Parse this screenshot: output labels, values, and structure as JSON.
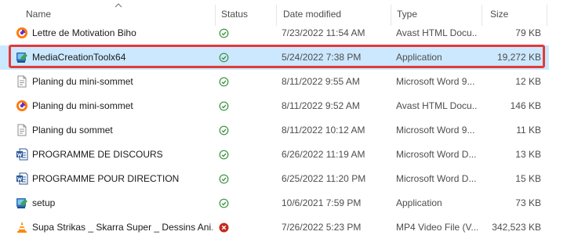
{
  "columns": {
    "name": "Name",
    "status": "Status",
    "date": "Date modified",
    "type": "Type",
    "size": "Size"
  },
  "files": [
    {
      "name": "Lettre de Motivation Biho",
      "status": "synced",
      "date": "7/23/2022 11:54 AM",
      "type": "Avast HTML Docu...",
      "size": "79 KB",
      "icon": "avast-icon"
    },
    {
      "name": "MediaCreationToolx64",
      "status": "synced",
      "date": "5/24/2022 7:38 PM",
      "type": "Application",
      "size": "19,272 KB",
      "icon": "installer-icon",
      "selected": true
    },
    {
      "name": "Planing du mini-sommet",
      "status": "synced",
      "date": "8/11/2022 9:55 AM",
      "type": "Microsoft Word 9...",
      "size": "12 KB",
      "icon": "document-icon"
    },
    {
      "name": "Planing du mini-sommet",
      "status": "synced",
      "date": "8/11/2022 9:52 AM",
      "type": "Avast HTML Docu...",
      "size": "146 KB",
      "icon": "avast-icon"
    },
    {
      "name": "Planing du sommet",
      "status": "synced",
      "date": "8/11/2022 10:12 AM",
      "type": "Microsoft Word 9...",
      "size": "11 KB",
      "icon": "document-icon"
    },
    {
      "name": "PROGRAMME DE DISCOURS",
      "status": "synced",
      "date": "6/26/2022 11:19 AM",
      "type": "Microsoft Word D...",
      "size": "13 KB",
      "icon": "word-icon"
    },
    {
      "name": "PROGRAMME POUR DIRECTION",
      "status": "synced",
      "date": "6/25/2022 11:20 PM",
      "type": "Microsoft Word D...",
      "size": "15 KB",
      "icon": "word-icon"
    },
    {
      "name": "setup",
      "status": "synced",
      "date": "10/6/2021 7:59 PM",
      "type": "Application",
      "size": "73 KB",
      "icon": "installer-icon"
    },
    {
      "name": "Supa Strikas _ Skarra Super _ Dessins Ani...",
      "status": "error",
      "date": "7/26/2022 5:23 PM",
      "type": "MP4 Video File (V...",
      "size": "342,523 KB",
      "icon": "vlc-icon"
    }
  ]
}
